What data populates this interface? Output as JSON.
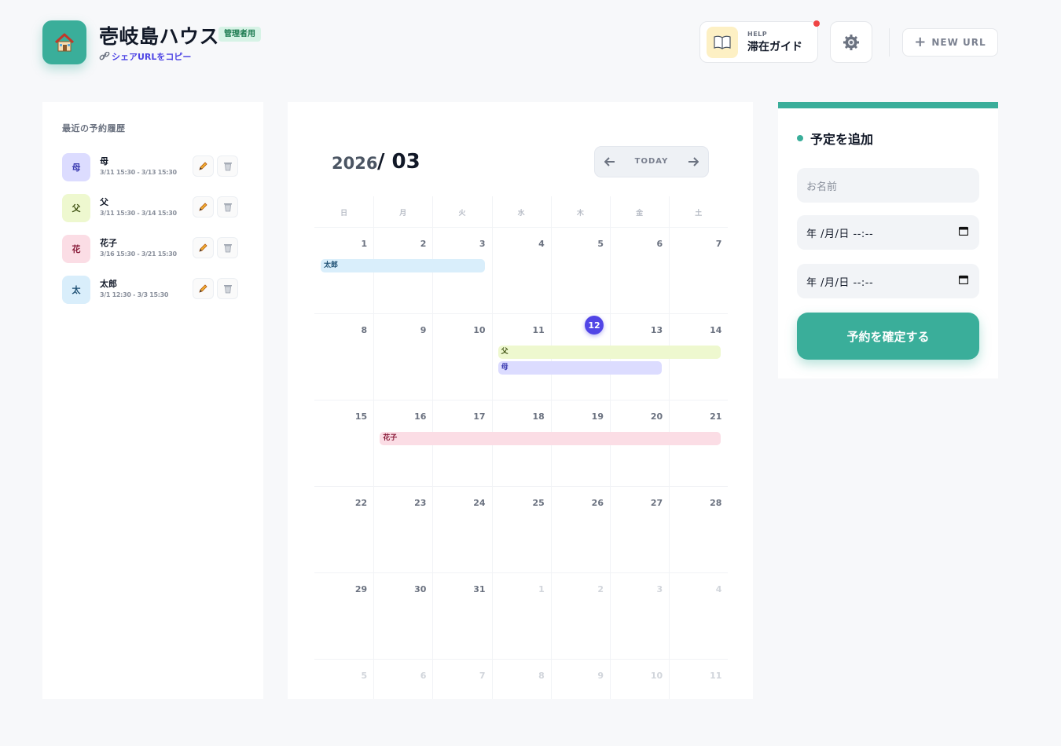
{
  "header": {
    "title": "壱岐島ハウス",
    "admin_badge": "管理者用",
    "share_link": "シェアURLをコピー",
    "guide_help": "HELP",
    "guide_label": "滞在ガイド",
    "new_url": "NEW URL"
  },
  "history": {
    "title": "最近の予約履歴",
    "items": [
      {
        "initial": "母",
        "name": "母",
        "range": "3/11 15:30 - 3/13 15:30",
        "bg": "#dcdcff",
        "fg": "#3b3bb0"
      },
      {
        "initial": "父",
        "name": "父",
        "range": "3/11 15:30 - 3/14 15:30",
        "bg": "#eef8cf",
        "fg": "#3f5212"
      },
      {
        "initial": "花",
        "name": "花子",
        "range": "3/16 15:30 - 3/21 15:30",
        "bg": "#fbdde5",
        "fg": "#8a1d3b"
      },
      {
        "initial": "太",
        "name": "太郎",
        "range": "3/1 12:30 - 3/3 15:30",
        "bg": "#d9eefb",
        "fg": "#1d4f73"
      }
    ]
  },
  "calendar": {
    "year": "2026",
    "month": "/ 03",
    "today_label": "TODAY",
    "weekdays": [
      "日",
      "月",
      "火",
      "水",
      "木",
      "金",
      "土"
    ],
    "weeks": [
      [
        "1",
        "2",
        "3",
        "4",
        "5",
        "6",
        "7"
      ],
      [
        "8",
        "9",
        "10",
        "11",
        "12",
        "13",
        "14"
      ],
      [
        "15",
        "16",
        "17",
        "18",
        "19",
        "20",
        "21"
      ],
      [
        "22",
        "23",
        "24",
        "25",
        "26",
        "27",
        "28"
      ],
      [
        "29",
        "30",
        "31",
        "1",
        "2",
        "3",
        "4"
      ],
      [
        "5",
        "6",
        "7",
        "8",
        "9",
        "10",
        "11"
      ]
    ],
    "today": "12",
    "bookings": [
      {
        "label": "太郎",
        "start": "3/1",
        "end": "3/3",
        "bg": "#d9eefb",
        "fg": "#1d4f73"
      },
      {
        "label": "父",
        "start": "3/11",
        "end": "3/14",
        "bg": "#eef8cf",
        "fg": "#3f5212"
      },
      {
        "label": "母",
        "start": "3/11",
        "end": "3/13",
        "bg": "#dcdcff",
        "fg": "#3b3bb0"
      },
      {
        "label": "花子",
        "start": "3/16",
        "end": "3/21",
        "bg": "#fbdde5",
        "fg": "#8a1d3b"
      }
    ]
  },
  "form": {
    "title": "予定を追加",
    "name_placeholder": "お名前",
    "checkin_value": "年 /月/日 --:--",
    "checkout_value": "年 /月/日 --:--",
    "submit": "予約を確定する"
  },
  "colors": {
    "accent": "#3aae9a",
    "today": "#5145e6"
  }
}
